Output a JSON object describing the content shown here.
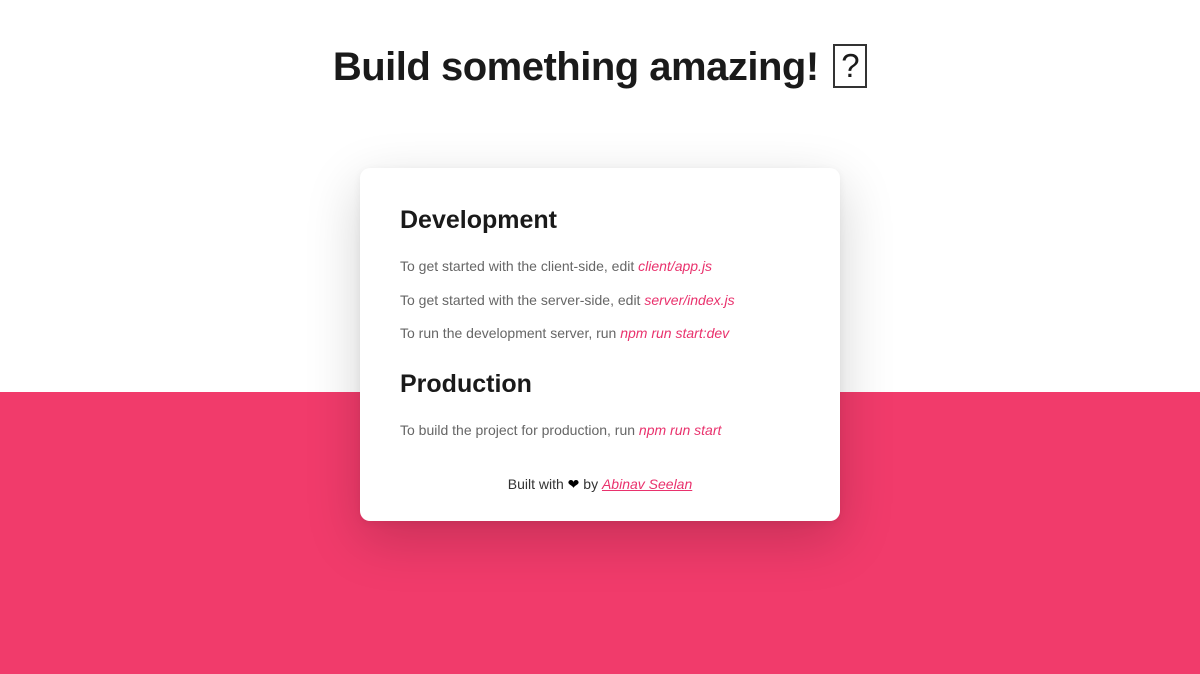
{
  "title": {
    "text": "Build something amazing!",
    "emoji": "?"
  },
  "card": {
    "dev": {
      "heading": "Development",
      "lines": [
        {
          "text": "To get started with the client-side, edit ",
          "code": "client/app.js"
        },
        {
          "text": "To get started with the server-side, edit ",
          "code": "server/index.js"
        },
        {
          "text": "To run the development server, run ",
          "code": "npm run start:dev"
        }
      ]
    },
    "prod": {
      "heading": "Production",
      "lines": [
        {
          "text": "To build the project for production, run ",
          "code": "npm run start"
        }
      ]
    },
    "footer": {
      "prefix": "Built with ",
      "heart": "❤",
      "by": " by ",
      "author": "Abinav Seelan"
    }
  }
}
